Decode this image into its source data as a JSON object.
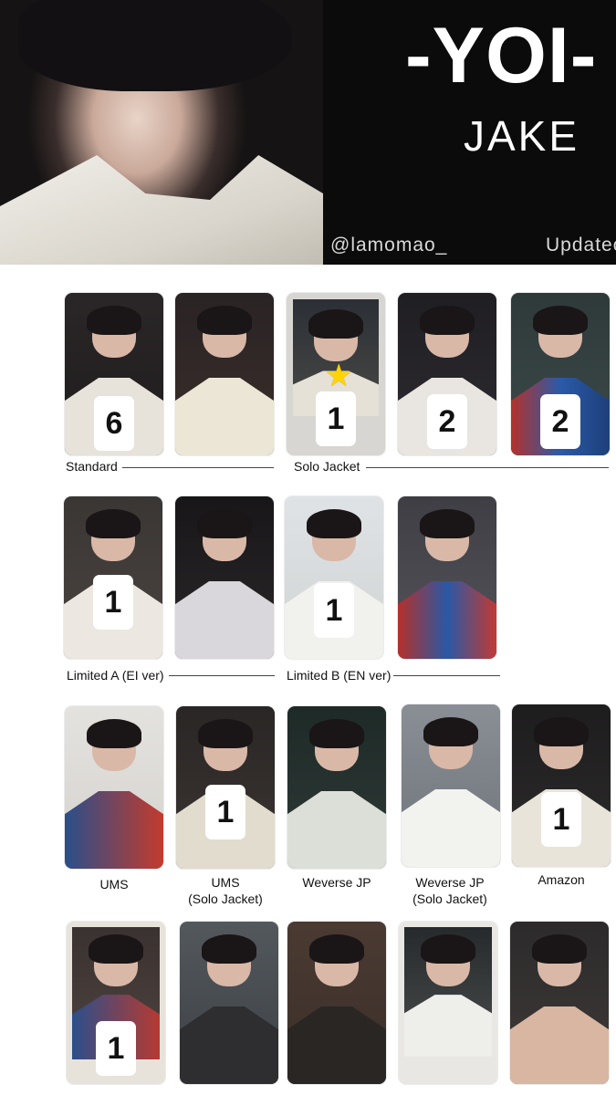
{
  "header": {
    "title": "-YOI-",
    "member": "JAKE",
    "handle": "@lamomao_",
    "updated": "Updatec"
  },
  "rows": [
    {
      "cards": [
        {
          "count": "6"
        },
        {
          "count": ""
        },
        {
          "count": "1"
        },
        {
          "count": "2"
        },
        {
          "count": "2"
        }
      ],
      "labels": [
        "Standard",
        "Solo Jacket"
      ]
    },
    {
      "cards": [
        {
          "count": "1"
        },
        {
          "count": ""
        },
        {
          "count": "1"
        },
        {
          "count": ""
        }
      ],
      "labels": [
        "Limited A (EI ver)",
        "Limited B (EN ver)"
      ]
    },
    {
      "cards": [
        {
          "count": "",
          "label1": "UMS",
          "label2": ""
        },
        {
          "count": "1",
          "label1": "UMS",
          "label2": "(Solo Jacket)"
        },
        {
          "count": "",
          "label1": "Weverse JP",
          "label2": ""
        },
        {
          "count": "",
          "label1": "Weverse JP",
          "label2": "(Solo Jacket)"
        },
        {
          "count": "1",
          "label1": "Amazon",
          "label2": ""
        }
      ]
    },
    {
      "cards": [
        {
          "count": "1"
        },
        {
          "count": ""
        },
        {
          "count": ""
        },
        {
          "count": ""
        },
        {
          "count": ""
        }
      ]
    }
  ],
  "colors": {
    "header_bg": "#0b0b0b",
    "page_bg": "#ffffff",
    "badge_bg": "#ffffff"
  }
}
